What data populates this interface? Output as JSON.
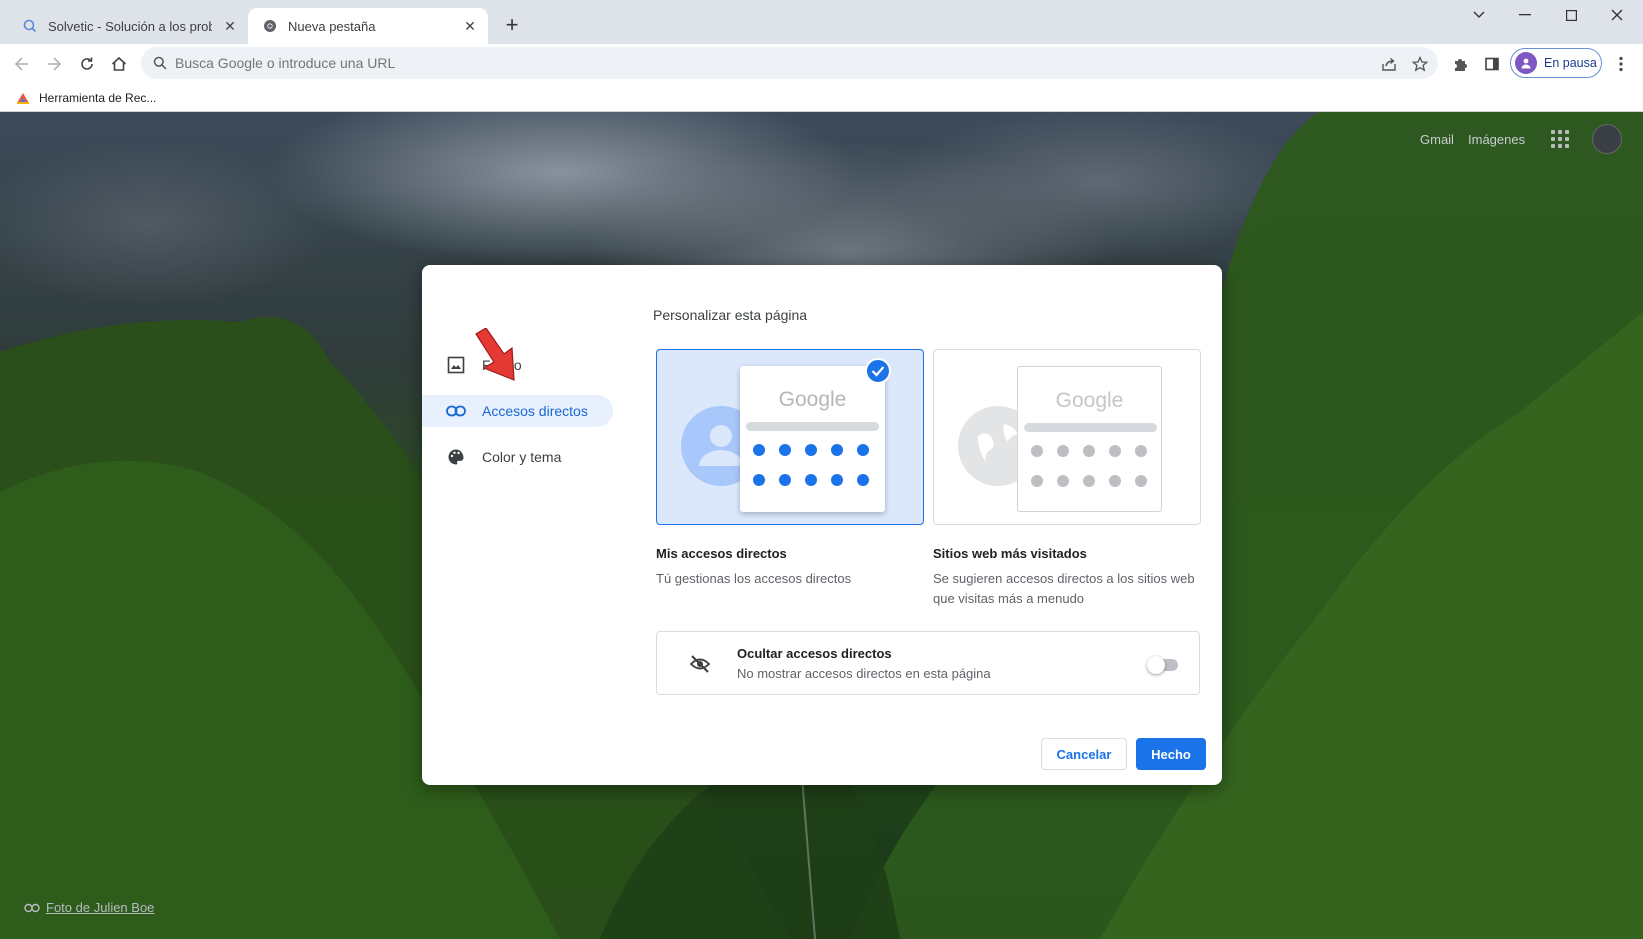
{
  "tabs": [
    {
      "title": "Solvetic - Solución a los problemas",
      "active": false
    },
    {
      "title": "Nueva pestaña",
      "active": true
    }
  ],
  "omnibox": {
    "placeholder": "Busca Google o introduce una URL"
  },
  "profile": {
    "label": "En pausa"
  },
  "bookmarks": [
    {
      "label": "Herramienta de Rec..."
    }
  ],
  "ntp": {
    "links": [
      "Gmail",
      "Imágenes"
    ],
    "photo_credit": "Foto de Julien Boe"
  },
  "dialog": {
    "title": "Personalizar esta página",
    "sidebar": [
      {
        "label": "Fondo",
        "icon": "image-icon",
        "active": false
      },
      {
        "label": "Accesos directos",
        "icon": "link-icon",
        "active": true
      },
      {
        "label": "Color y tema",
        "icon": "palette-icon",
        "active": false
      }
    ],
    "options": [
      {
        "title": "Mis accesos directos",
        "desc": "Tú gestionas los accesos directos",
        "selected": true,
        "logo": "Google"
      },
      {
        "title": "Sitios web más visitados",
        "desc": "Se sugieren accesos directos a los sitios web que visitas más a menudo",
        "selected": false,
        "logo": "Google"
      }
    ],
    "hide": {
      "title": "Ocultar accesos directos",
      "desc": "No mostrar accesos directos en esta página",
      "enabled": false
    },
    "buttons": {
      "cancel": "Cancelar",
      "done": "Hecho"
    }
  },
  "colors": {
    "accent": "#1a73e8",
    "selected_bg": "#dbe7fb",
    "annotation_arrow": "#e53935"
  }
}
